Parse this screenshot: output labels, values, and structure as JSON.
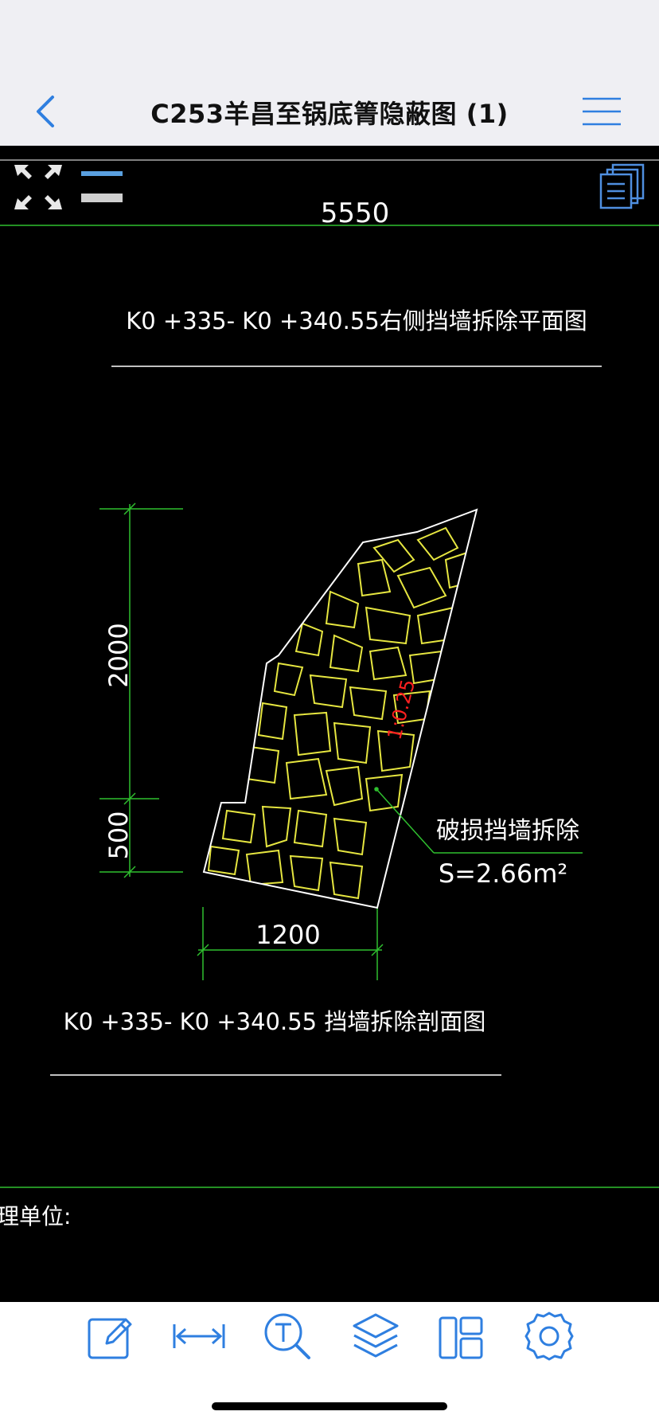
{
  "nav": {
    "title": "C253羊昌至锅底箐隐蔽图 (1)",
    "back_icon": "chevron-left-icon",
    "menu_icon": "hamburger-menu-icon",
    "accent": "#2f7fe0"
  },
  "drawing": {
    "top_dimension": "5550",
    "plan_title": "K0 +335- K0 +340.55右侧挡墙拆除平面图",
    "dim_height_upper": "2000",
    "dim_height_lower": "500",
    "dim_width": "1200",
    "slope_label": "1:0.25",
    "annotation_line1": "破损挡墙拆除",
    "annotation_line2": "S=2.66m²",
    "section_title": "K0 +335- K0 +340.55 挡墙拆除剖面图",
    "partial_label": "理单位:",
    "colors": {
      "dimension": "#2fbf2f",
      "stone": "#e6e640",
      "outline": "#ffffff",
      "slope": "#ff2020",
      "text": "#ffffff"
    }
  },
  "toolbar": {
    "items": [
      {
        "icon": "pencil-edit-icon"
      },
      {
        "icon": "measure-distance-icon"
      },
      {
        "icon": "text-search-icon"
      },
      {
        "icon": "layers-icon"
      },
      {
        "icon": "layout-icon"
      },
      {
        "icon": "settings-gear-icon"
      }
    ]
  }
}
